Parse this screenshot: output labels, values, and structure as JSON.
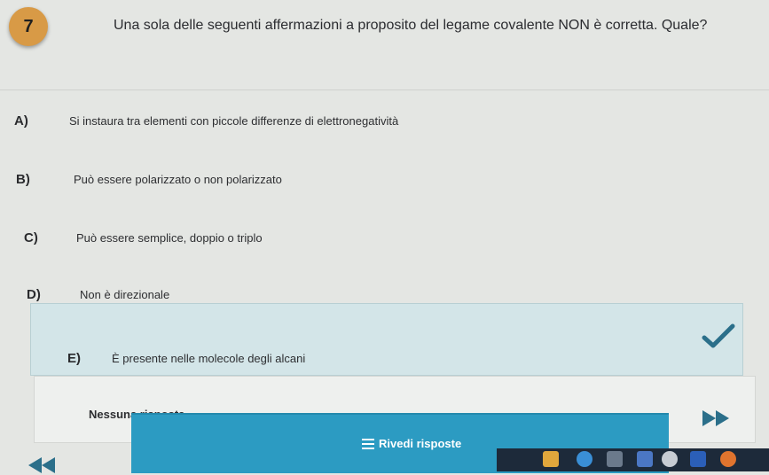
{
  "question": {
    "number": "7",
    "text": "Una sola delle seguenti affermazioni a proposito del legame covalente NON è corretta. Quale?"
  },
  "options": [
    {
      "letter": "A)",
      "text": "Si instaura tra elementi con piccole differenze di elettronegatività"
    },
    {
      "letter": "B)",
      "text": "Può essere polarizzato o non polarizzato"
    },
    {
      "letter": "C)",
      "text": "Può essere semplice, doppio o triplo"
    },
    {
      "letter": "D)",
      "text": "Non è direzionale"
    },
    {
      "letter": "E)",
      "text": "È presente nelle molecole degli alcani",
      "selected": true
    }
  ],
  "no_answer_label": "Nessuna risposta",
  "review_label": "Rivedi risposte",
  "icons": {
    "check": "check-icon",
    "next": "fast-forward-icon",
    "prev": "rewind-icon",
    "review": "menu-icon"
  },
  "colors": {
    "question_badge": "#d89a46",
    "selected_bg": "#d3e5e8",
    "check": "#2b6f8a",
    "button": "#2c9bc2",
    "taskbar": "#1d2a3a"
  }
}
